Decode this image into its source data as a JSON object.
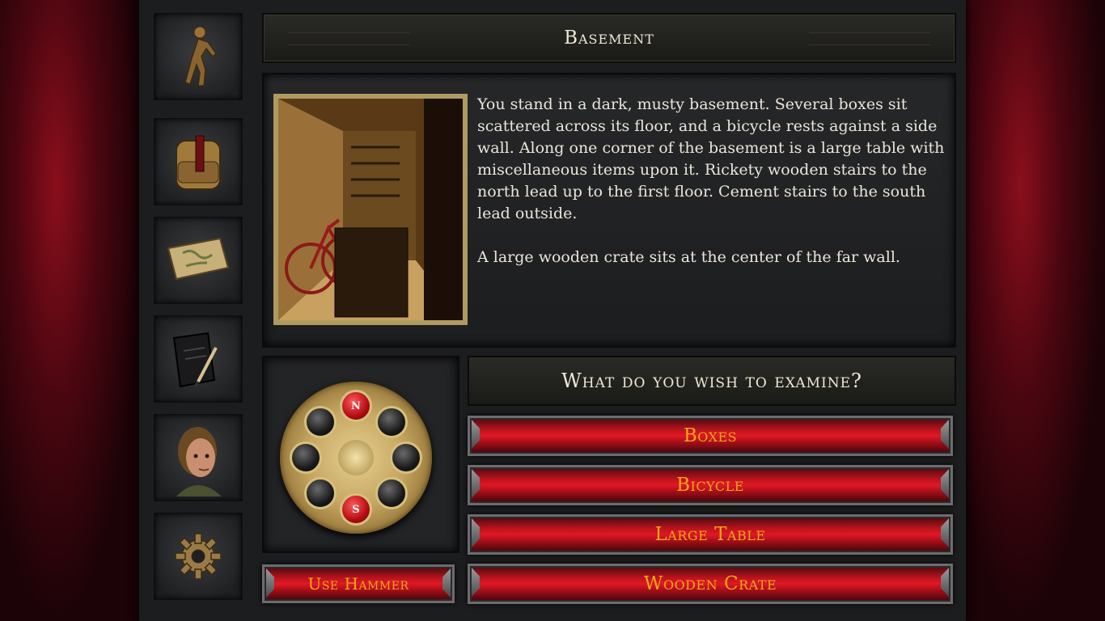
{
  "location": {
    "title": "Basement"
  },
  "description": {
    "text": "You stand in a dark, musty basement.  Several boxes sit scattered across its floor, and a bicycle rests against a side wall.  Along one corner of the basement is a large table with miscellaneous items upon it.  Rickety wooden stairs to the north lead up to the first floor.  Cement stairs to the south lead outside.\n\nA large wooden crate sits at the center of the far wall."
  },
  "sidebar": {
    "items": [
      {
        "icon": "walking-person-icon"
      },
      {
        "icon": "backpack-icon"
      },
      {
        "icon": "map-scroll-icon"
      },
      {
        "icon": "journal-icon"
      },
      {
        "icon": "character-portrait-icon"
      },
      {
        "icon": "gear-icon"
      }
    ]
  },
  "compass": {
    "north_label": "N",
    "south_label": "S"
  },
  "action": {
    "use_item_label": "Use Hammer"
  },
  "examine": {
    "prompt": "What do you wish to examine?",
    "options": [
      "Boxes",
      "Bicycle",
      "Large Table",
      "Wooden Crate"
    ]
  },
  "colors": {
    "accent_red": "#c0141e",
    "button_text": "#f0a818",
    "gold": "#c6a662"
  }
}
